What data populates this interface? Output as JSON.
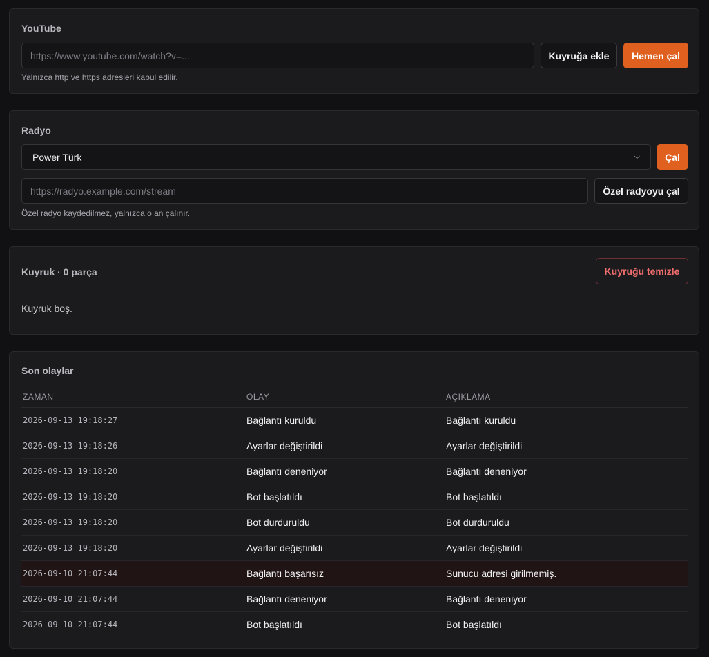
{
  "youtube": {
    "title": "YouTube",
    "url_placeholder": "https://www.youtube.com/watch?v=...",
    "url_value": "",
    "queue_button": "Kuyruğa ekle",
    "play_now_button": "Hemen çal",
    "hint": "Yalnızca http ve https adresleri kabul edilir."
  },
  "radio": {
    "title": "Radyo",
    "selected_station": "Power Türk",
    "play_button": "Çal",
    "custom_placeholder": "https://radyo.example.com/stream",
    "custom_value": "",
    "custom_play_button": "Özel radyoyu çal",
    "hint": "Özel radyo kaydedilmez, yalnızca o an çalınır."
  },
  "queue": {
    "title": "Kuyruk · 0 parça",
    "clear_button": "Kuyruğu temizle",
    "empty_text": "Kuyruk boş."
  },
  "events": {
    "title": "Son olaylar",
    "columns": [
      "ZAMAN",
      "OLAY",
      "AÇIKLAMA"
    ],
    "rows": [
      {
        "time": "2026-09-13 19:18:27",
        "event": "Bağlantı kuruldu",
        "description": "Bağlantı kuruldu",
        "error": false
      },
      {
        "time": "2026-09-13 19:18:26",
        "event": "Ayarlar değiştirildi",
        "description": "Ayarlar değiştirildi",
        "error": false
      },
      {
        "time": "2026-09-13 19:18:20",
        "event": "Bağlantı deneniyor",
        "description": "Bağlantı deneniyor",
        "error": false
      },
      {
        "time": "2026-09-13 19:18:20",
        "event": "Bot başlatıldı",
        "description": "Bot başlatıldı",
        "error": false
      },
      {
        "time": "2026-09-13 19:18:20",
        "event": "Bot durduruldu",
        "description": "Bot durduruldu",
        "error": false
      },
      {
        "time": "2026-09-13 19:18:20",
        "event": "Ayarlar değiştirildi",
        "description": "Ayarlar değiştirildi",
        "error": false
      },
      {
        "time": "2026-09-10 21:07:44",
        "event": "Bağlantı başarısız",
        "description": "Sunucu adresi girilmemiş.",
        "error": true
      },
      {
        "time": "2026-09-10 21:07:44",
        "event": "Bağlantı deneniyor",
        "description": "Bağlantı deneniyor",
        "error": false
      },
      {
        "time": "2026-09-10 21:07:44",
        "event": "Bot başlatıldı",
        "description": "Bot başlatıldı",
        "error": false
      }
    ]
  },
  "colors": {
    "accent": "#e0601f",
    "danger": "#ef6d6d",
    "background": "#111113",
    "card": "#1b1b1e"
  },
  "icons": {
    "select_arrow": "chevron-down-icon"
  }
}
